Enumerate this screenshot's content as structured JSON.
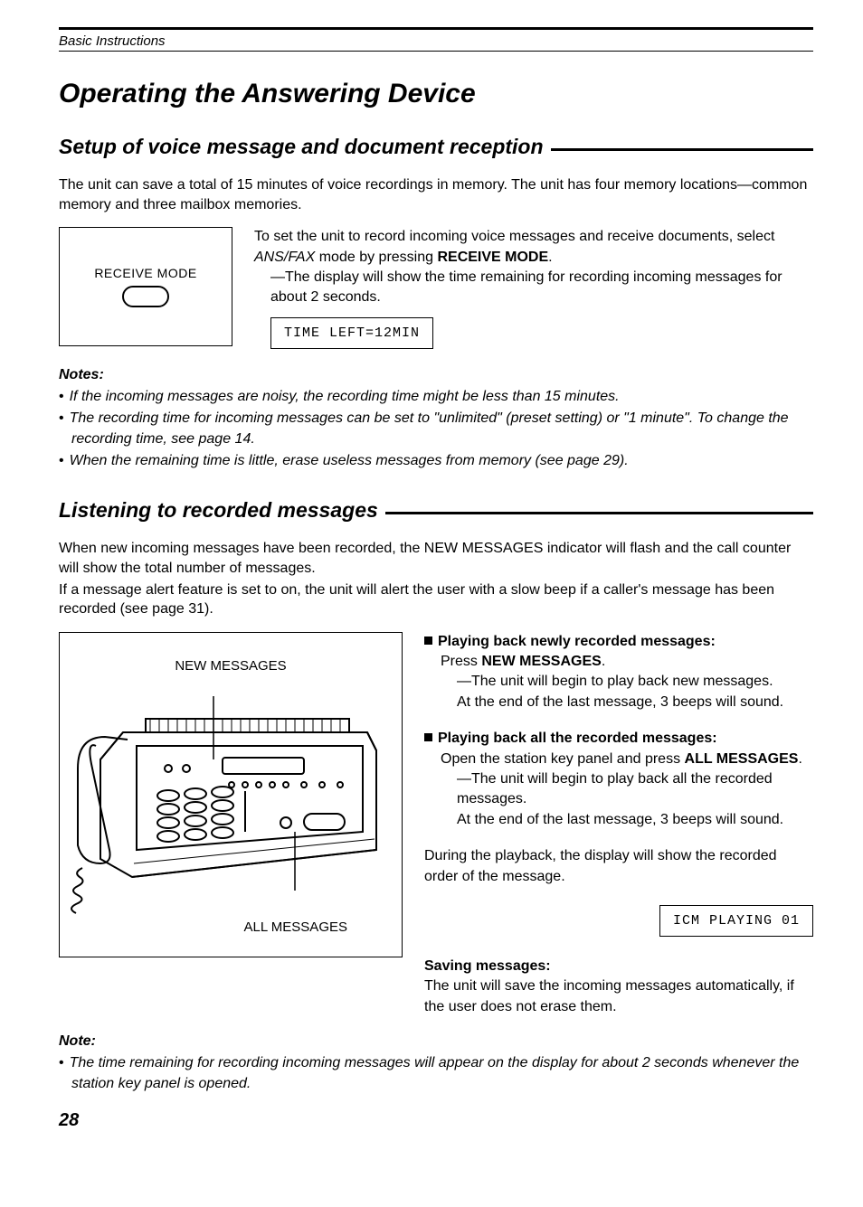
{
  "header": {
    "section": "Basic Instructions"
  },
  "title": "Operating the Answering Device",
  "section1": {
    "heading": "Setup of voice message and document reception",
    "intro": "The unit can save a total of 15 minutes of voice recordings in memory. The unit has four memory locations—common memory and three mailbox memories.",
    "button_label": "RECEIVE MODE",
    "p1a": "To set the unit to record incoming voice messages and receive documents, select ",
    "p1b": "ANS/FAX",
    "p1c": " mode by pressing ",
    "p1d": "RECEIVE MODE",
    "p1e": ".",
    "p2": "—The display will show the time remaining for recording incoming messages for about 2 seconds.",
    "lcd": "TIME LEFT=12MIN",
    "notes_label": "Notes:",
    "notes": [
      "If the incoming messages are noisy, the recording time might be less than 15 minutes.",
      "The recording time for incoming messages can be set to \"unlimited\" (preset setting) or \"1 minute\". To change the recording time, see page 14.",
      "When the remaining time is little, erase useless messages from memory (see page 29)."
    ]
  },
  "section2": {
    "heading": "Listening to recorded messages",
    "intro1": "When new incoming messages have been recorded, the NEW MESSAGES indicator will flash and the call counter will show the total number of messages.",
    "intro2": "If a message alert feature is set to on, the unit will alert the user with a slow beep if a caller's message has been recorded (see page 31).",
    "device_label_top": "NEW MESSAGES",
    "device_label_bottom": "ALL MESSAGES",
    "play_new_head": "Playing back newly recorded messages:",
    "play_new_a": "Press ",
    "play_new_b": "NEW MESSAGES",
    "play_new_c": ".",
    "play_new_sub1": "—The unit will begin to play back new messages.",
    "play_new_sub2": "At the end of the last message, 3 beeps will sound.",
    "play_all_head": "Playing back all the recorded messages:",
    "play_all_a": "Open the station key panel and press ",
    "play_all_b": "ALL MESSAGES",
    "play_all_c": ".",
    "play_all_sub1": "—The unit will begin to play back all the recorded messages.",
    "play_all_sub2": "At the end of the last message, 3 beeps will sound.",
    "during": "During the playback, the display will show the recorded order of the message.",
    "lcd": "ICM PLAYING 01",
    "saving_head": "Saving messages:",
    "saving_body": "The unit will save the incoming messages automatically, if the user does not erase them.",
    "note_label": "Note:",
    "note_body": "The time remaining for recording incoming messages will appear on the display for about 2 seconds whenever the station key panel is opened."
  },
  "page_number": "28"
}
